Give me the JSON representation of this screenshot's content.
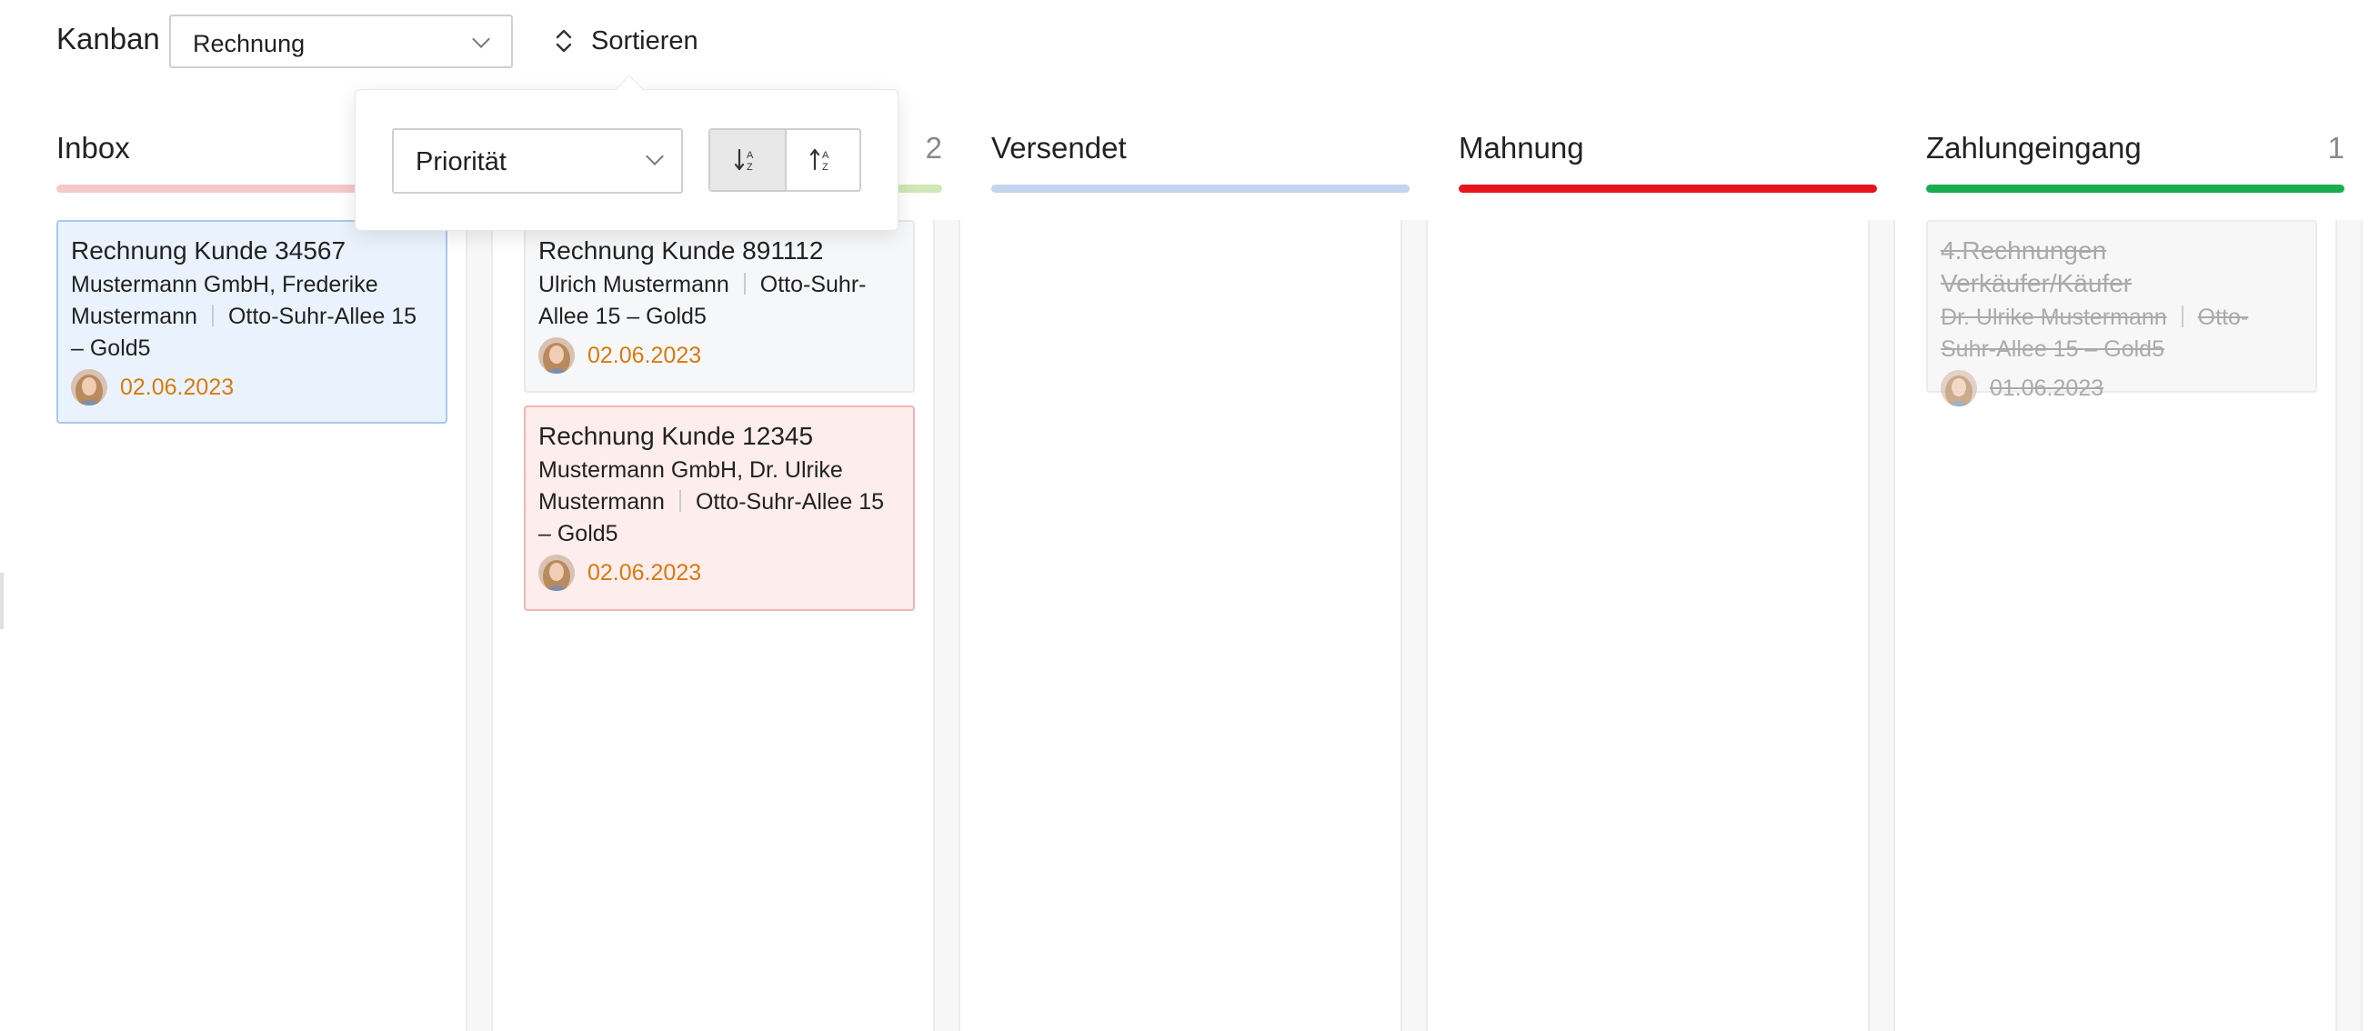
{
  "header": {
    "title": "Kanban",
    "board_select": {
      "value": "Rechnung"
    },
    "sort_button": {
      "label": "Sortieren",
      "icon": "sort-updown-icon"
    }
  },
  "sort_popover": {
    "field_select": {
      "value": "Priorität"
    },
    "direction": {
      "options": [
        {
          "name": "descending",
          "icon": "sort-desc-icon",
          "active": true
        },
        {
          "name": "ascending",
          "icon": "sort-asc-icon",
          "active": false
        }
      ]
    }
  },
  "columns": [
    {
      "title": "Inbox",
      "count": "",
      "color": "#f6c9c9",
      "cards": [
        {
          "title": "Rechnung Kunde 34567",
          "company": "Mustermann GmbH, Frederike Mustermann",
          "address": "Otto-Suhr-Allee 15 – Gold5",
          "date": "02.06.2023",
          "state": "selected",
          "bg": "#eaf3fd",
          "border": "#a9c9ef"
        }
      ]
    },
    {
      "title": "",
      "count": "2",
      "color": "#cfe8b5",
      "cards": [
        {
          "title": "Rechnung Kunde 891112",
          "company": "Ulrich Mustermann",
          "address": "Otto-Suhr-Allee 15 – Gold5",
          "date": "02.06.2023",
          "state": "normal",
          "bg": "#f6f7f9",
          "border": "#e6e8ec"
        },
        {
          "title": "Rechnung Kunde 12345",
          "company": "Mustermann GmbH, Dr. Ulrike Mustermann",
          "address": "Otto-Suhr-Allee 15 – Gold5",
          "date": "02.06.2023",
          "state": "alert",
          "bg": "#fdeded",
          "border": "#f2b5b5"
        }
      ]
    },
    {
      "title": "Versendet",
      "count": "",
      "color": "#c4d3ee",
      "cards": []
    },
    {
      "title": "Mahnung",
      "count": "",
      "color": "#e8141c",
      "cards": []
    },
    {
      "title": "Zahlungeingang",
      "count": "1",
      "color": "#1aad4f",
      "cards": [
        {
          "title": "4.Rechnungen Verkäufer/Käufer",
          "company": "Dr. Ulrike Mustermann",
          "address": "Otto-Suhr-Allee 15 – Gold5",
          "date": "01.06.2023",
          "state": "done",
          "bg": "#f7f7f7",
          "border": "#ececec"
        }
      ]
    }
  ]
}
